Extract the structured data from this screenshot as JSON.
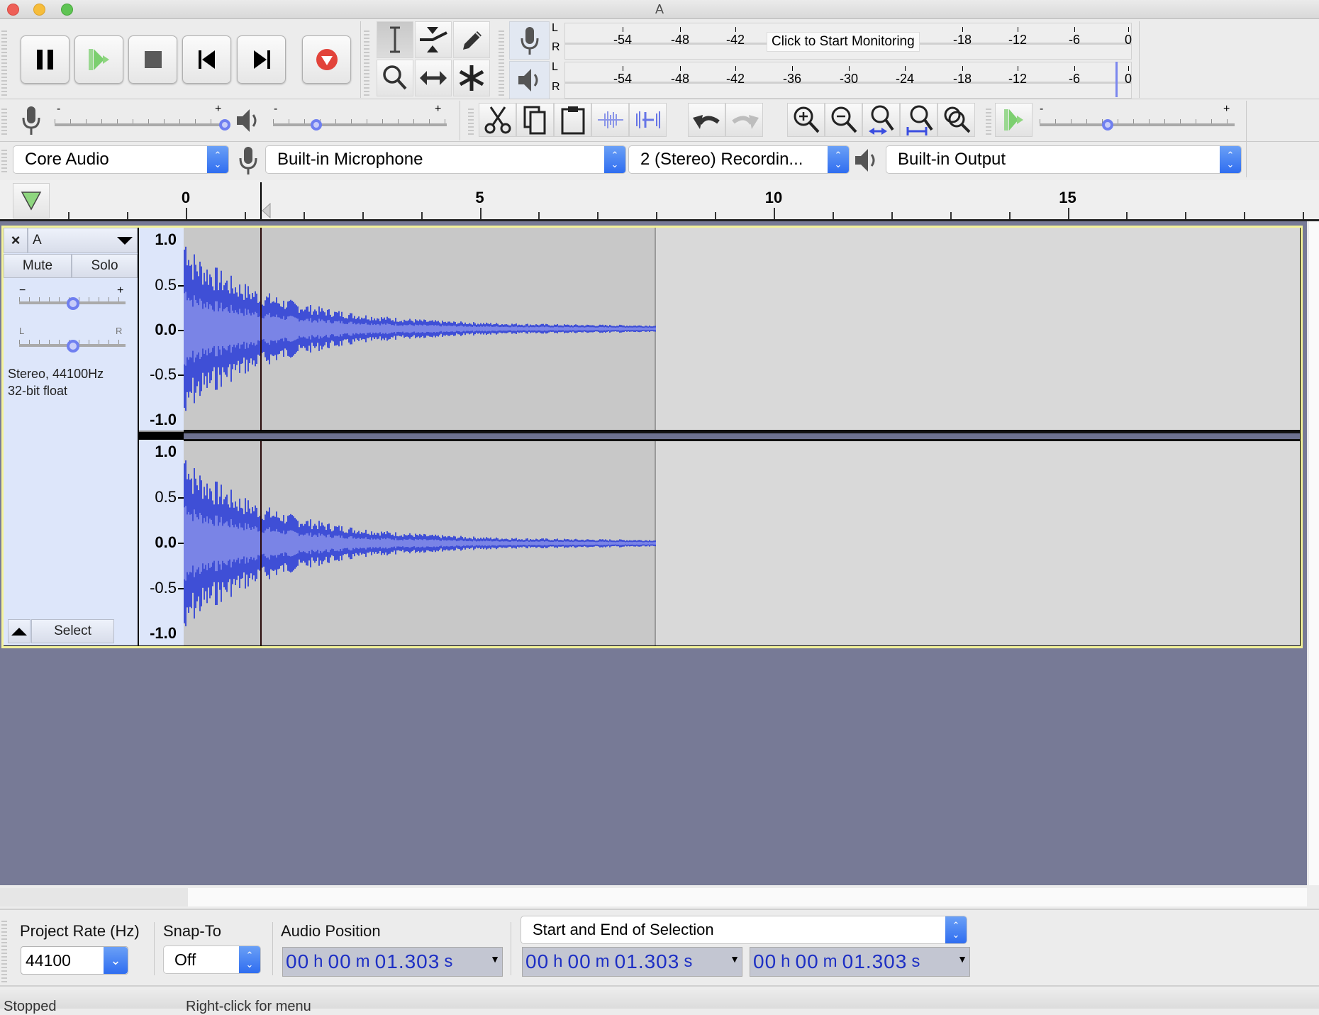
{
  "window": {
    "title": "A"
  },
  "transport": {
    "buttons": [
      {
        "name": "pause",
        "icon": "pause-icon"
      },
      {
        "name": "play",
        "icon": "play-icon"
      },
      {
        "name": "stop",
        "icon": "stop-icon"
      },
      {
        "name": "skip-to-start",
        "icon": "skip-start-icon"
      },
      {
        "name": "skip-to-end",
        "icon": "skip-end-icon"
      },
      {
        "name": "record",
        "icon": "record-icon"
      }
    ]
  },
  "tools": [
    "selection-tool",
    "envelope-tool",
    "draw-tool",
    "zoom-tool",
    "time-shift-tool",
    "multi-tool"
  ],
  "meters": {
    "record": {
      "L": "L",
      "R": "R",
      "ticks": [
        "-54",
        "-48",
        "-42",
        "-18",
        "-12",
        "-6",
        "0"
      ],
      "monitor_label": "Click to Start Monitoring"
    },
    "playback": {
      "L": "L",
      "R": "R",
      "ticks": [
        "-54",
        "-48",
        "-42",
        "-36",
        "-30",
        "-24",
        "-18",
        "-12",
        "-6",
        "0"
      ]
    }
  },
  "mixer": {
    "record_volume": {
      "min_label": "-",
      "max_label": "+",
      "value": 1.0
    },
    "playback_volume": {
      "min_label": "-",
      "max_label": "+",
      "value": 0.25
    }
  },
  "edit_tools": [
    "cut",
    "copy",
    "paste",
    "trim-audio",
    "silence-audio",
    "undo",
    "redo",
    "zoom-in",
    "zoom-out",
    "fit-selection",
    "fit-project",
    "zoom-toggle"
  ],
  "play_at_speed": {
    "min_label": "-",
    "max_label": "+",
    "value": 0.35
  },
  "devices": {
    "host": "Core Audio",
    "input": "Built-in Microphone",
    "channels": "2 (Stereo) Recordin...",
    "output": "Built-in Output"
  },
  "ruler": {
    "labels": [
      "0",
      "5",
      "10",
      "15"
    ],
    "cursor_seconds": 1.303
  },
  "track": {
    "name": "A",
    "close_label": "×",
    "mute_label": "Mute",
    "solo_label": "Solo",
    "gain": {
      "min_label": "−",
      "max_label": "+",
      "value": 0.5
    },
    "pan": {
      "min_label": "L",
      "max_label": "R",
      "value": 0.5
    },
    "info_line1": "Stereo, 44100Hz",
    "info_line2": "32-bit float",
    "select_label": "Select",
    "vruler_labels": [
      "1.0",
      "0.5",
      "0.0",
      "-0.5",
      "-1.0"
    ],
    "clip_end_seconds": 8.0
  },
  "selection_toolbar": {
    "project_rate_label": "Project Rate (Hz)",
    "project_rate": "44100",
    "snap_to_label": "Snap-To",
    "snap_to": "Off",
    "audio_position_label": "Audio Position",
    "selection_mode": "Start and End of Selection",
    "audio_position": {
      "hh": "00",
      "mm": "00",
      "ss": "01.303"
    },
    "selection_start": {
      "hh": "00",
      "mm": "00",
      "ss": "01.303"
    },
    "selection_end": {
      "hh": "00",
      "mm": "00",
      "ss": "01.303"
    },
    "units": {
      "h": "h",
      "m": "m",
      "s": "s"
    }
  },
  "status": {
    "state": "Stopped",
    "hint": "Right-click for menu"
  }
}
